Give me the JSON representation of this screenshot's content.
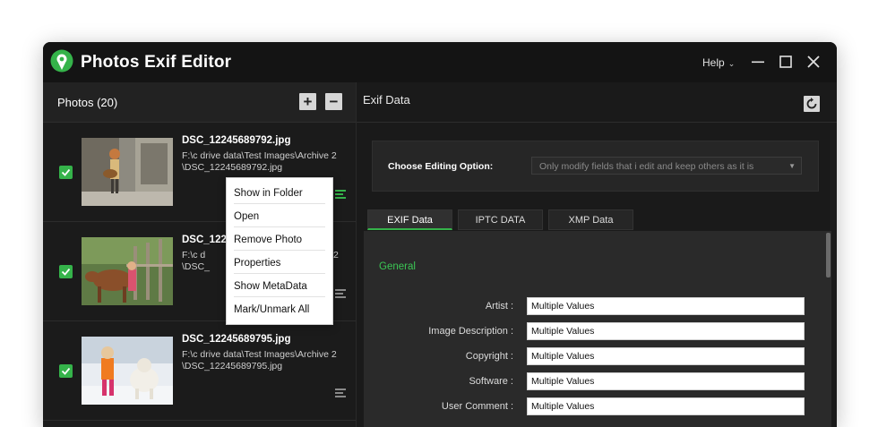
{
  "app": {
    "title": "Photos Exif Editor",
    "help_label": "Help",
    "colors": {
      "accent": "#35b34a",
      "window_bg": "#121212",
      "panel_bg": "#1c1c1c"
    }
  },
  "window_controls": [
    "minimize-icon",
    "maximize-icon",
    "close-icon"
  ],
  "photos_panel": {
    "title": "Photos (20)",
    "add_label": "+",
    "remove_label": "−",
    "items": [
      {
        "file": "DSC_12245689792.jpg",
        "path": "F:\\c drive data\\Test Images\\Archive 2\n\\DSC_12245689792.jpg",
        "checked": true
      },
      {
        "file": "DSC_1224",
        "path": "F:\\c d\n\\DSC_",
        "path_tail": "2",
        "checked": true
      },
      {
        "file": "DSC_12245689795.jpg",
        "path": "F:\\c drive data\\Test Images\\Archive 2\n\\DSC_12245689795.jpg",
        "checked": true
      }
    ]
  },
  "context_menu": {
    "items": [
      "Show in Folder",
      "Open",
      "Remove Photo",
      "Properties",
      "Show MetaData",
      "Mark/Unmark All"
    ]
  },
  "exif_panel": {
    "title": "Exif Data",
    "editing_option_label": "Choose Editing Option:",
    "editing_option_value": "Only modify fields that i edit and keep others as it is",
    "tabs": [
      "EXIF Data",
      "IPTC DATA",
      "XMP Data"
    ],
    "active_tab": "EXIF Data",
    "section": "General",
    "fields": [
      {
        "label": "Artist :",
        "value": "Multiple Values"
      },
      {
        "label": "Image Description :",
        "value": "Multiple Values"
      },
      {
        "label": "Copyright :",
        "value": "Multiple Values"
      },
      {
        "label": "Software :",
        "value": "Multiple Values"
      },
      {
        "label": "User Comment :",
        "value": "Multiple Values"
      }
    ]
  }
}
